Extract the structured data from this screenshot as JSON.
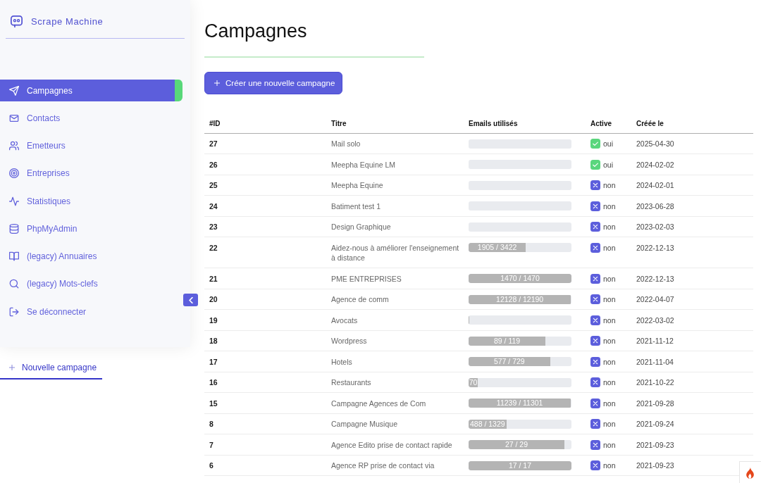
{
  "app": {
    "name": "Scrape Machine"
  },
  "sidebar": {
    "items": [
      {
        "label": "Campagnes",
        "selected": true
      },
      {
        "label": "Contacts",
        "selected": false
      },
      {
        "label": "Emetteurs",
        "selected": false
      },
      {
        "label": "Entreprises",
        "selected": false
      },
      {
        "label": "Statistiques",
        "selected": false
      },
      {
        "label": "PhpMyAdmin",
        "selected": false
      },
      {
        "label": "(legacy) Annuaires",
        "selected": false
      },
      {
        "label": "(legacy) Mots-clefs",
        "selected": false
      },
      {
        "label": "Se déconnecter",
        "selected": false
      }
    ]
  },
  "new_campaign_link": {
    "label": "Nouvelle campagne"
  },
  "page": {
    "title": "Campagnes",
    "create_button": {
      "label": "Créer une nouvelle campagne"
    }
  },
  "table": {
    "columns": [
      "#ID",
      "Titre",
      "Emails utilisés",
      "Active",
      "Créée le"
    ],
    "rows": [
      {
        "id": "27",
        "title": "Mail solo",
        "active": true,
        "active_label": "oui",
        "created": "2025-04-30"
      },
      {
        "id": "26",
        "title": "Meepha Equine LM",
        "active": true,
        "active_label": "oui",
        "created": "2024-02-02"
      },
      {
        "id": "25",
        "title": "Meepha Equine",
        "active": false,
        "active_label": "non",
        "created": "2024-02-01"
      },
      {
        "id": "24",
        "title": "Batiment test 1",
        "active": false,
        "active_label": "non",
        "created": "2023-06-28"
      },
      {
        "id": "23",
        "title": "Design Graphique",
        "active": false,
        "active_label": "non",
        "created": "2023-02-03"
      },
      {
        "id": "22",
        "title": "Aidez-nous à améliorer l'enseignement à distance",
        "emails": {
          "level": 0.556,
          "reading": "1905 / 3422"
        },
        "active": false,
        "active_label": "non",
        "created": "2022-12-13"
      },
      {
        "id": "21",
        "title": "PME ENTREPRISES",
        "emails": {
          "level": 1,
          "reading": "1470 / 1470"
        },
        "active": false,
        "active_label": "non",
        "created": "2022-12-13"
      },
      {
        "id": "20",
        "title": "Agence de comm",
        "emails": {
          "level": 0.995,
          "reading": "12128 / 12190"
        },
        "active": false,
        "active_label": "non",
        "created": "2022-04-07"
      },
      {
        "id": "19",
        "title": "Avocats",
        "emails": {
          "level": 0.01
        },
        "active": false,
        "active_label": "non",
        "created": "2022-03-02"
      },
      {
        "id": "18",
        "title": "Wordpress",
        "emails": {
          "level": 0.748,
          "reading": "89 / 119"
        },
        "active": false,
        "active_label": "non",
        "created": "2021-11-12"
      },
      {
        "id": "17",
        "title": "Hotels",
        "emails": {
          "level": 0.792,
          "reading": "577 / 729"
        },
        "active": false,
        "active_label": "non",
        "created": "2021-11-04"
      },
      {
        "id": "16",
        "title": "Restaurants",
        "emails": {
          "level": 0.09,
          "reading": "70"
        },
        "active": false,
        "active_label": "non",
        "created": "2021-10-22"
      },
      {
        "id": "15",
        "title": "Campagne Agences de Com",
        "emails": {
          "level": 0.995,
          "reading": "11239 / 11301"
        },
        "active": false,
        "active_label": "non",
        "created": "2021-09-28"
      },
      {
        "id": "8",
        "title": "Campagne Musique",
        "emails": {
          "level": 0.367,
          "reading": "488 / 1329"
        },
        "active": false,
        "active_label": "non",
        "created": "2021-09-24"
      },
      {
        "id": "7",
        "title": "Agence Edito prise de contact rapide",
        "emails": {
          "level": 0.931,
          "reading": "27 / 29"
        },
        "active": false,
        "active_label": "non",
        "created": "2021-09-23"
      },
      {
        "id": "6",
        "title": "Agence RP prise de contact via",
        "emails": {
          "level": 1,
          "reading": "17 / 17"
        },
        "active": false,
        "active_label": "non",
        "created": "2021-09-23"
      }
    ]
  }
}
